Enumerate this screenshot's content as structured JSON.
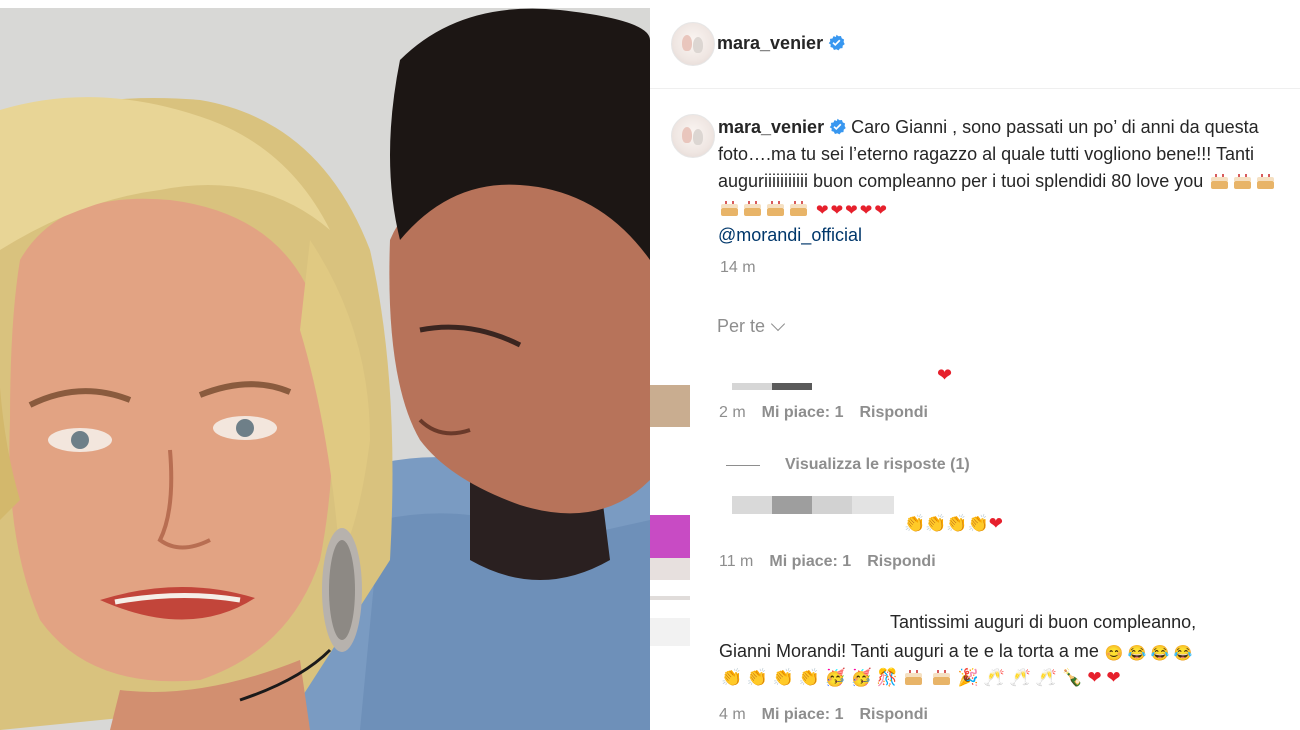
{
  "post": {
    "username": "mara_venier",
    "verified": true
  },
  "caption": {
    "username": "mara_venier",
    "text": "Caro Gianni , sono passati un po’ di anni da questa foto….ma tu sei l’eterno ragazzo al quale tutti vogliono bene!!! Tanti auguriiiiiiiiiii buon compleanno per i tuoi splendidi 80 love you",
    "emoji_trailer": [
      "birthday-cake",
      "birthday-cake",
      "birthday-cake",
      "birthday-cake",
      "birthday-cake",
      "birthday-cake",
      "birthday-cake",
      "red-heart",
      "red-heart",
      "red-heart",
      "red-heart",
      "red-heart"
    ],
    "mention": "@morandi_official",
    "time": "14 m"
  },
  "comments_filter": {
    "label": "Per te"
  },
  "comments": [
    {
      "emoji": "❤️",
      "time": "2 m",
      "likes": "Mi piace: 1",
      "reply_label": "Rispondi",
      "view_replies": "Visualizza le risposte (1)"
    },
    {
      "emoji": "👏👏👏👏❤️",
      "time": "11 m",
      "likes": "Mi piace: 1",
      "reply_label": "Rispondi"
    },
    {
      "text_line1": "Tantissimi auguri di buon compleanno,",
      "text_line2": "Gianni Morandi! Tanti auguri a te e la torta a me",
      "emoji_line1": "😊😂😂😂",
      "emoji_line2": "👏👏👏👏🥳🥳🎊🎂🎂🎉🥂🥂🥂🍾❤️❤️",
      "time": "4 m",
      "likes": "Mi piace: 1",
      "reply_label": "Rispondi"
    }
  ],
  "colors": {
    "verified": "#3897f0",
    "link": "#00376b",
    "heart": "#e6202c",
    "muted": "#8e8e8e"
  }
}
